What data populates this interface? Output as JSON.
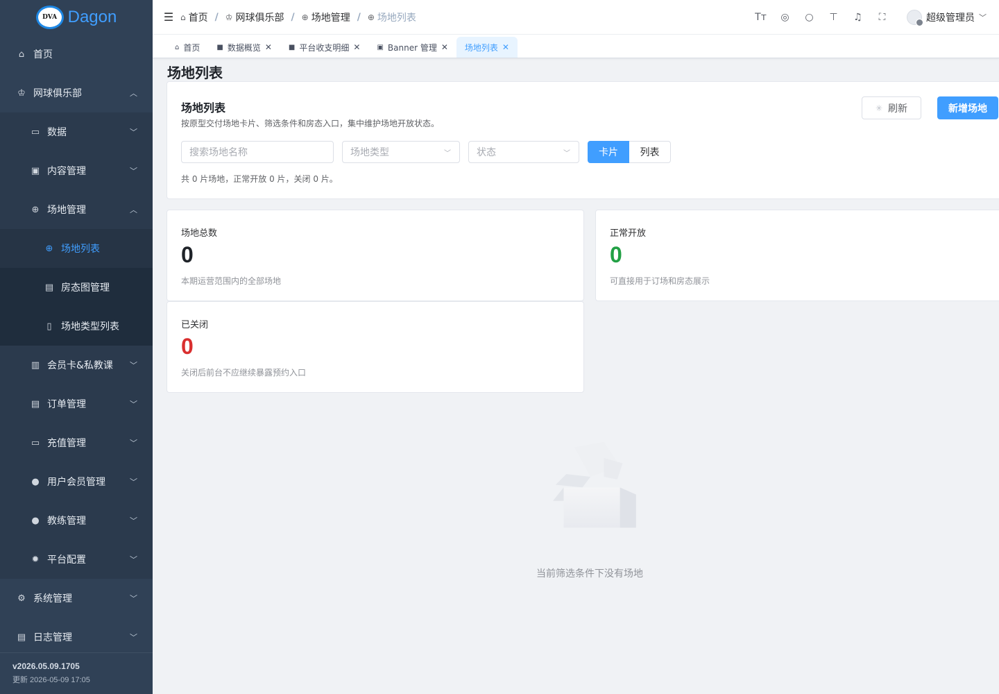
{
  "app": {
    "name": "Dagon",
    "logo_text": "DVA"
  },
  "sidebar": {
    "items": [
      {
        "label": "首页",
        "icon": "home-icon",
        "level": 0
      },
      {
        "label": "网球俱乐部",
        "icon": "trophy-icon",
        "level": 0,
        "expanded": true
      },
      {
        "label": "数据",
        "icon": "chart-icon",
        "level": 1,
        "expanded": false
      },
      {
        "label": "内容管理",
        "icon": "image-icon",
        "level": 1,
        "expanded": false
      },
      {
        "label": "场地管理",
        "icon": "basketball-icon",
        "level": 1,
        "expanded": true
      },
      {
        "label": "场地列表",
        "icon": "basketball-icon",
        "level": 2,
        "active": true
      },
      {
        "label": "房态图管理",
        "icon": "calendar-icon",
        "level": 2
      },
      {
        "label": "场地类型列表",
        "icon": "bookmark-icon",
        "level": 2
      },
      {
        "label": "会员卡&私教课",
        "icon": "book-icon",
        "level": 1,
        "expanded": false
      },
      {
        "label": "订单管理",
        "icon": "document-icon",
        "level": 1,
        "expanded": false
      },
      {
        "label": "充值管理",
        "icon": "folder-icon",
        "level": 1,
        "expanded": false
      },
      {
        "label": "用户会员管理",
        "icon": "user-icon",
        "level": 1,
        "expanded": false
      },
      {
        "label": "教练管理",
        "icon": "user-icon",
        "level": 1,
        "expanded": false
      },
      {
        "label": "平台配置",
        "icon": "gear-icon",
        "level": 1,
        "expanded": false
      },
      {
        "label": "系统管理",
        "icon": "cog-icon",
        "level": 0,
        "expanded": false
      },
      {
        "label": "日志管理",
        "icon": "log-icon",
        "level": 0,
        "expanded": false
      }
    ],
    "footer": {
      "version": "v2026.05.09.1705",
      "updated": "更新 2026-05-09 17:05"
    }
  },
  "navbar": {
    "breadcrumb": [
      "首页",
      "网球俱乐部",
      "场地管理",
      "场地列表"
    ],
    "user": "超级管理员"
  },
  "tags": [
    {
      "label": "首页",
      "closable": false
    },
    {
      "label": "数据概览",
      "closable": true
    },
    {
      "label": "平台收支明细",
      "closable": true
    },
    {
      "label": "Banner 管理",
      "closable": true
    },
    {
      "label": "场地列表",
      "closable": true,
      "active": true
    }
  ],
  "page": {
    "title": "场地列表",
    "panel": {
      "title": "场地列表",
      "description": "按原型交付场地卡片、筛选条件和房态入口，集中维护场地开放状态。",
      "refresh_label": "刷新",
      "add_label": "新增场地",
      "search_placeholder": "搜索场地名称",
      "type_placeholder": "场地类型",
      "status_placeholder": "状态",
      "view_card": "卡片",
      "view_list": "列表",
      "summary": "共 0 片场地，正常开放 0 片，关闭 0 片。"
    },
    "stats": [
      {
        "label": "场地总数",
        "value": "0",
        "note": "本期运营范围内的全部场地",
        "color": "#1f2329"
      },
      {
        "label": "正常开放",
        "value": "0",
        "note": "可直接用于订场和房态展示",
        "color": "#22a045"
      },
      {
        "label": "已关闭",
        "value": "0",
        "note": "关闭后前台不应继续暴露预约入口",
        "color": "#d92f2f"
      }
    ],
    "empty_text": "当前筛选条件下没有场地"
  },
  "colors": {
    "sidebar_bg": "#304156",
    "primary": "#409eff",
    "active_menu": "#409eff"
  }
}
